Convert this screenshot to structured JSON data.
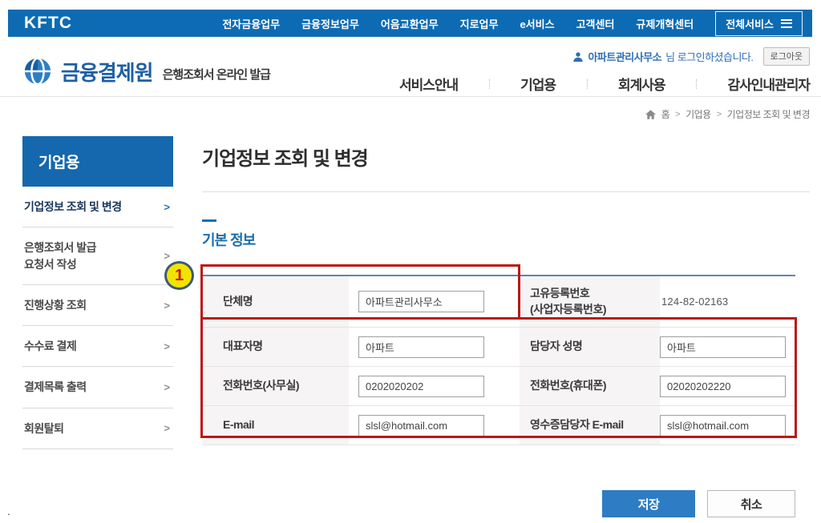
{
  "topbar": {
    "brand": "KFTC",
    "items": [
      "전자금융업무",
      "금융정보업무",
      "어음교환업무",
      "지로업무",
      "e서비스",
      "고객센터",
      "규제개혁센터"
    ],
    "all_services_label": "전체서비스"
  },
  "header": {
    "logo_text": "금융결제원",
    "logo_subtitle": "은행조회서 온라인 발급",
    "login_user": "아파트관리사무소",
    "login_message": "님 로그인하셨습니다.",
    "logout_label": "로그아웃",
    "nav": [
      "서비스안내",
      "기업용",
      "회계사용",
      "감사인내관리자"
    ]
  },
  "breadcrumb": {
    "home": "홈",
    "sep": ">",
    "items": [
      "기업용",
      "기업정보 조회 및 변경"
    ]
  },
  "sidebar": {
    "title": "기업용",
    "chevron": ">",
    "items": [
      "기업정보 조회 및 변경",
      "은행조회서 발급\n요청서 작성",
      "진행상황 조회",
      "수수료 결제",
      "결제목록 출력",
      "회원탈퇴"
    ]
  },
  "main": {
    "title": "기업정보 조회 및 변경",
    "section_title": "기본 정보",
    "form": {
      "rows": [
        {
          "c1label": "단체명",
          "c1value": "아파트관리사무소",
          "c2label": "고유등록번호\n(사업자등록번호)",
          "c2value": "124-82-02163"
        },
        {
          "c1label": "대표자명",
          "c1value": "아파트",
          "c2label": "담당자 성명",
          "c2value": "아파트"
        },
        {
          "c1label": "전화번호(사무실)",
          "c1value": "0202020202",
          "c2label": "전화번호(휴대폰)",
          "c2value": "02020202220"
        },
        {
          "c1label": "E-mail",
          "c1value": "slsl@hotmail.com",
          "c2label": "영수증담당자 E-mail",
          "c2value": "slsl@hotmail.com"
        }
      ]
    },
    "save_label": "저장",
    "cancel_label": "취소"
  },
  "annotation": {
    "badge": "1"
  },
  "misc": {
    "stray_dot": "."
  },
  "colors": {
    "topbar_blue": "#0d6bb3",
    "sidebar_blue": "#1568ae",
    "accent_blue": "#1a6fad",
    "save_button_blue": "#2e7cc3",
    "annotation_red": "#bb1717",
    "badge_yellow": "#f2e400",
    "badge_border": "#3d5a78"
  }
}
